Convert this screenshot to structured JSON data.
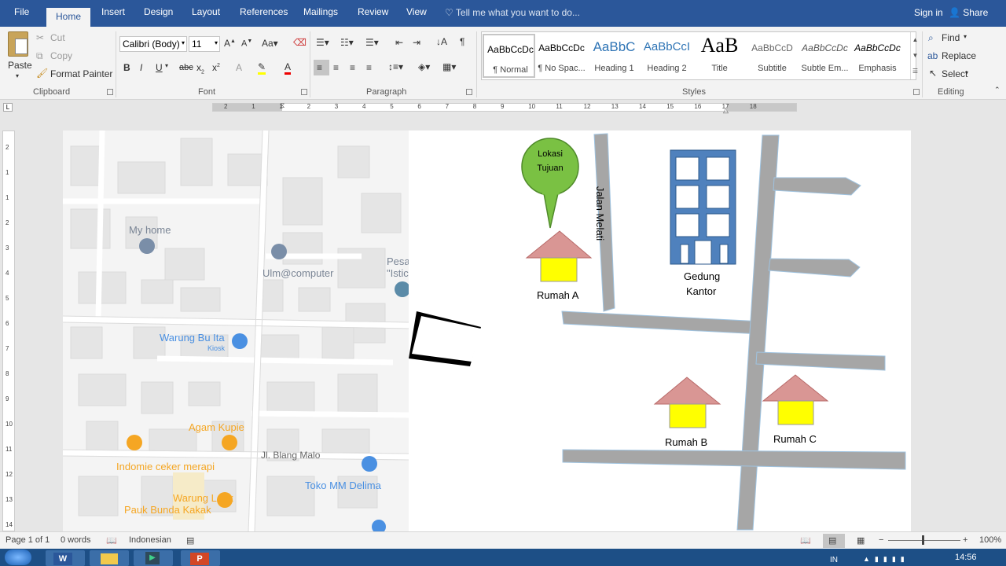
{
  "tabs": {
    "file": "File",
    "home": "Home",
    "insert": "Insert",
    "design": "Design",
    "layout": "Layout",
    "references": "References",
    "mailings": "Mailings",
    "review": "Review",
    "view": "View"
  },
  "tell_me": "Tell me what you want to do...",
  "sign_in": "Sign in",
  "share": "Share",
  "clipboard": {
    "paste": "Paste",
    "cut": "Cut",
    "copy": "Copy",
    "format_painter": "Format Painter",
    "group": "Clipboard"
  },
  "font": {
    "name": "Calibri (Body)",
    "size": "11",
    "group": "Font"
  },
  "paragraph": {
    "group": "Paragraph"
  },
  "styles": {
    "group": "Styles",
    "items": [
      {
        "preview": "AaBbCcDc",
        "name": "¶ Normal"
      },
      {
        "preview": "AaBbCcDc",
        "name": "¶ No Spac..."
      },
      {
        "preview": "AaBbC",
        "name": "Heading 1"
      },
      {
        "preview": "AaBbCcI",
        "name": "Heading 2"
      },
      {
        "preview": "AaB",
        "name": "Title"
      },
      {
        "preview": "AaBbCcD",
        "name": "Subtitle"
      },
      {
        "preview": "AaBbCcDc",
        "name": "Subtle Em..."
      },
      {
        "preview": "AaBbCcDc",
        "name": "Emphasis"
      }
    ]
  },
  "editing": {
    "find": "Find",
    "replace": "Replace",
    "select": "Select",
    "group": "Editing"
  },
  "ruler_numbers": [
    "2",
    "1",
    "1",
    "2",
    "3",
    "4",
    "5",
    "6",
    "7",
    "8",
    "9",
    "10",
    "11",
    "12",
    "13",
    "14",
    "15",
    "16",
    "17",
    "18"
  ],
  "vruler_numbers": [
    "2",
    "1",
    "1",
    "2",
    "3",
    "4",
    "5",
    "6",
    "7",
    "8",
    "9",
    "10",
    "11",
    "12",
    "13",
    "14"
  ],
  "map": {
    "my_home": "My home",
    "ulm": "Ulm@computer",
    "pesa1": "Pesa",
    "pesa2": "\"Istic",
    "warung_bu_ita": "Warung Bu Ita",
    "kiosk": "Kiosk",
    "agam": "Agam Kupie",
    "blang_malo": "Jl. Blang Malo",
    "indomie": "Indomie ceker merapi",
    "toko": "Toko MM Delima",
    "warung_lauk1": "Warung Lauk",
    "warung_lauk2": "Pauk Bunda Kakak"
  },
  "drawing": {
    "lokasi1": "Lokasi",
    "lokasi2": "Tujuan",
    "jalan": "Jalan Melati",
    "rumah_a": "Rumah A",
    "gedung1": "Gedung",
    "gedung2": "Kantor",
    "rumah_b": "Rumah B",
    "rumah_c": "Rumah C"
  },
  "status": {
    "page": "Page 1 of 1",
    "words": "0 words",
    "language": "Indonesian",
    "zoom": "100%"
  },
  "taskbar": {
    "lang": "IN",
    "time": "14:56"
  },
  "colors": {
    "word_blue": "#2b579a",
    "road": "#a6a6a6",
    "roof": "#d99694",
    "wall": "#ffff00",
    "bubble": "#7ac143",
    "building": "#4f81bd"
  }
}
